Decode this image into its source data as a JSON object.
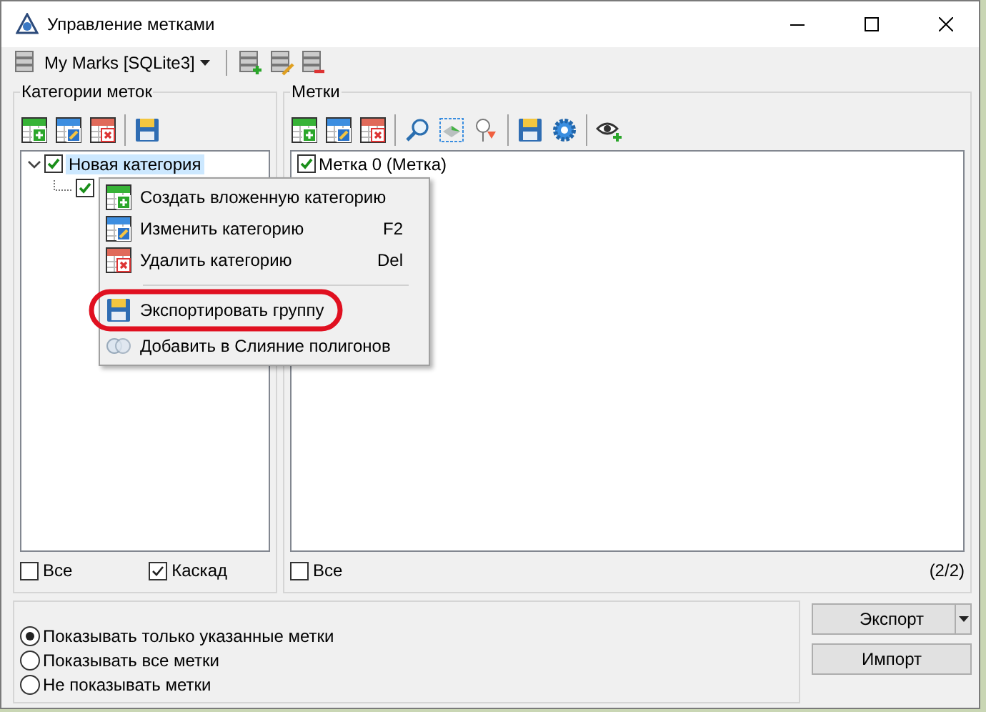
{
  "window": {
    "title": "Управление метками"
  },
  "toolbar": {
    "database": "My Marks [SQLite3]"
  },
  "categories_panel": {
    "title": "Категории меток",
    "tree": [
      {
        "label": "Новая категория",
        "checked": true,
        "selected": true,
        "expanded": true,
        "children": [
          {
            "checked": true
          }
        ]
      }
    ],
    "all_checkbox": {
      "label": "Все",
      "checked": false
    },
    "cascade_checkbox": {
      "label": "Каскад",
      "checked": true
    }
  },
  "marks_panel": {
    "title": "Метки",
    "items": [
      {
        "label": "Метка 0 (Метка)",
        "checked": true
      }
    ],
    "all_checkbox": {
      "label": "Все",
      "checked": false
    },
    "count": "(2/2)"
  },
  "display_options": [
    {
      "label": "Показывать только указанные метки",
      "selected": true
    },
    {
      "label": "Показывать все метки",
      "selected": false
    },
    {
      "label": "Не показывать метки",
      "selected": false
    }
  ],
  "buttons": [
    {
      "label": "Экспорт",
      "kind": "split"
    },
    {
      "label": "Импорт",
      "kind": "plain"
    }
  ],
  "context_menu": {
    "items": [
      {
        "kind": "item",
        "label": "Создать вложенную категорию",
        "annotated": false
      },
      {
        "kind": "item",
        "label": "Изменить категорию",
        "shortcut": "F2",
        "annotated": false
      },
      {
        "kind": "item",
        "label": "Удалить категорию",
        "shortcut": "Del",
        "annotated": false
      },
      {
        "kind": "separator"
      },
      {
        "kind": "item",
        "label": "Экспортировать группу",
        "annotated": true
      },
      {
        "kind": "item",
        "label": "Добавить в Слияние полигонов",
        "annotated": false
      }
    ]
  }
}
